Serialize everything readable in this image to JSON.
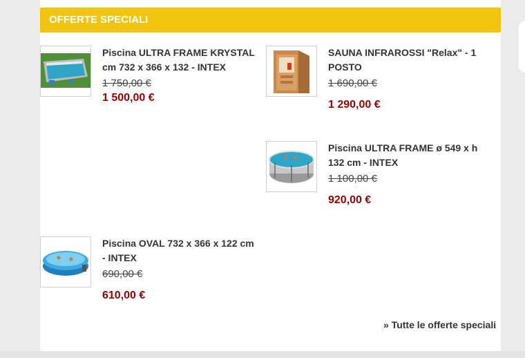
{
  "section": {
    "title": "OFFERTE SPECIALI"
  },
  "products": [
    {
      "name": "Piscina ULTRA FRAME KRYSTAL cm 732 x 366 x 132 - INTEX",
      "old_price": "1 750,00 €",
      "new_price": "1 500,00 €",
      "image_icon": "rectangular-pool-image"
    },
    {
      "name": "SAUNA INFRAROSSI \"Relax\" - 1 POSTO",
      "old_price": "1 690,00 €",
      "new_price": "1 290,00 €",
      "image_icon": "sauna-cabin-image"
    },
    {
      "name": "Piscina ULTRA FRAME ø 549 x h 132 cm - INTEX",
      "old_price": "1 100,00 €",
      "new_price": "920,00 €",
      "image_icon": "round-pool-image"
    },
    {
      "name": "Piscina OVAL 732 x 366 x 122 cm - INTEX",
      "old_price": "690,00 €",
      "new_price": "610,00 €",
      "image_icon": "oval-pool-image"
    }
  ],
  "footer": {
    "all_offers_link": "» Tutte le offerte speciali"
  },
  "colors": {
    "header_bg": "#f1c40f",
    "price_red": "#990000",
    "text_dark": "#333333"
  }
}
